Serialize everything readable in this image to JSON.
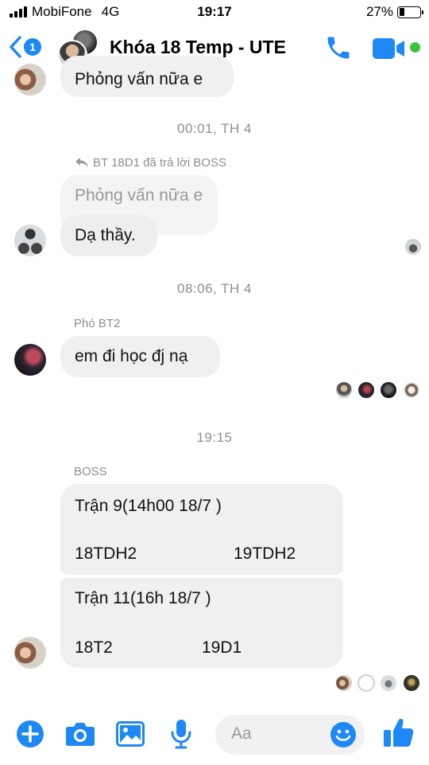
{
  "status_bar": {
    "carrier": "MobiFone",
    "network": "4G",
    "time": "19:17",
    "battery_percent": "27%",
    "battery_level": 0.27
  },
  "header": {
    "unread_count": "1",
    "title": "Khóa 18 Temp - UTE",
    "icons": [
      "back-chevron-icon",
      "phone-icon",
      "video-camera-icon"
    ],
    "accent_color": "#1e88f5",
    "active_status_color": "#3ac43a"
  },
  "messages": [
    {
      "text": "Phỏng vấn nữa e"
    },
    {
      "timestamp": "00:01, TH 4"
    },
    {
      "reply_note": "BT 18D1 đã trả lời BOSS",
      "quoted": "Phỏng vấn nữa e",
      "text": "Dạ thầy."
    },
    {
      "timestamp": "08:06, TH 4"
    },
    {
      "sender": "Phó BT2",
      "text": "em đi học đj nạ"
    },
    {
      "timestamp": "19:15"
    },
    {
      "sender": "BOSS",
      "match_1": {
        "title": "Trận 9(14h00 18/7 )",
        "team_a": "18TDH2",
        "team_b": "19TDH2"
      },
      "match_2": {
        "title": "Trận 11(16h 18/7 )",
        "team_a": "18T2",
        "team_b": "19D1"
      }
    }
  ],
  "composer": {
    "placeholder": "Aa",
    "icons": [
      "plus-icon",
      "camera-icon",
      "image-icon",
      "microphone-icon",
      "emoji-icon",
      "thumbs-up-icon"
    ]
  }
}
